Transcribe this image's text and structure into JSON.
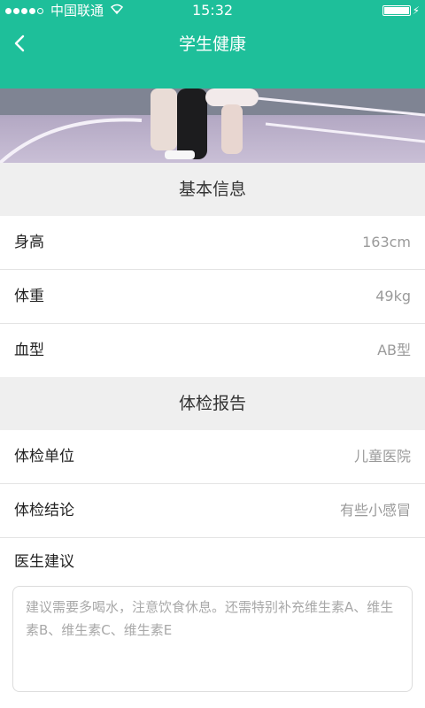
{
  "status_bar": {
    "carrier": "中国联通",
    "wifi_icon": "wifi-icon",
    "time": "15:32",
    "battery_level": 1.0
  },
  "nav": {
    "title": "学生健康",
    "back_icon": "chevron-left-icon"
  },
  "colors": {
    "accent": "#1ebf9a",
    "section_bg": "#efefef",
    "value_text": "#9a9a9a"
  },
  "basic_info": {
    "section_title": "基本信息",
    "items": [
      {
        "label": "身高",
        "value": "163cm"
      },
      {
        "label": "体重",
        "value": "49kg"
      },
      {
        "label": "血型",
        "value": "AB型"
      }
    ]
  },
  "exam_report": {
    "section_title": "体检报告",
    "items": [
      {
        "label": "体检单位",
        "value": "儿童医院"
      },
      {
        "label": "体检结论",
        "value": "有些小感冒"
      }
    ],
    "advice_label": "医生建议",
    "advice_text": "建议需要多喝水，注意饮食休息。还需特别补充维生素A、维生素B、维生素C、维生素E"
  }
}
